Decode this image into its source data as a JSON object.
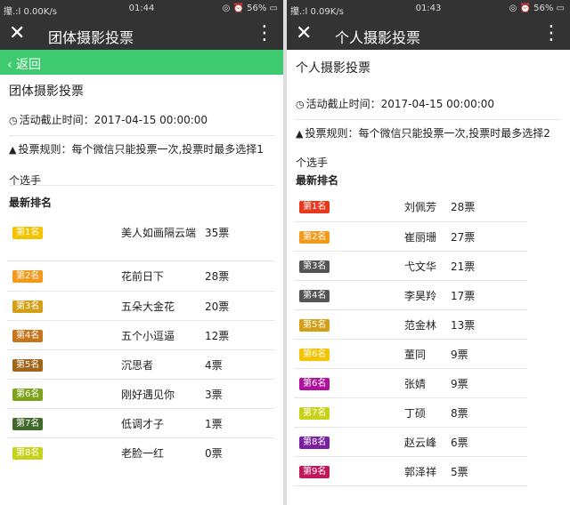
{
  "status_left": {
    "signal": "攥.:l",
    "speed": "0.00K/s",
    "time": "01:44",
    "battery": "56%"
  },
  "status_right": {
    "signal": "攥.:l",
    "speed": "0.09K/s",
    "time": "01:43",
    "battery": "56%"
  },
  "left": {
    "nav_title": "团体摄影投票",
    "back_label": "‹ 返回",
    "page_title": "团体摄影投票",
    "deadline": "活动截止时间：2017-04-15 00:00:00",
    "rule_line1": "投票规则：每个微信只能投票一次,投票时最多选择1",
    "rule_line2": "个选手",
    "section": "最新排名",
    "rows": [
      {
        "rank": "第1名",
        "color": "#f5c400",
        "name": "美人如画隔云端",
        "votes": "35票"
      },
      {
        "rank": "第2名",
        "color": "#f39a1d",
        "name": "花前日下",
        "votes": "28票"
      },
      {
        "rank": "第3名",
        "color": "#d4a017",
        "name": "五朵大金花",
        "votes": "20票"
      },
      {
        "rank": "第4名",
        "color": "#c8741a",
        "name": "五个小逗逼",
        "votes": "12票"
      },
      {
        "rank": "第5名",
        "color": "#a0661a",
        "name": "沉思者",
        "votes": "4票"
      },
      {
        "rank": "第6名",
        "color": "#7ea21a",
        "name": "刚好遇见你",
        "votes": "3票"
      },
      {
        "rank": "第7名",
        "color": "#3f6a2c",
        "name": "低调才子",
        "votes": "1票"
      },
      {
        "rank": "第8名",
        "color": "#c6d21a",
        "name": "老脸一红",
        "votes": "0票"
      }
    ]
  },
  "right": {
    "nav_title": "个人摄影投票",
    "page_title": "个人摄影投票",
    "deadline": "活动截止时间：2017-04-15 00:00:00",
    "rule_line1": "投票规则：每个微信只能投票一次,投票时最多选择2",
    "rule_line2": "个选手",
    "section": "最新排名",
    "rows": [
      {
        "rank": "第1名",
        "color": "#e8391e",
        "name": "刘佩芳",
        "votes": "28票"
      },
      {
        "rank": "第2名",
        "color": "#f39a1d",
        "name": "崔丽珊",
        "votes": "27票"
      },
      {
        "rank": "第3名",
        "color": "#555555",
        "name": "弋文华",
        "votes": "21票"
      },
      {
        "rank": "第4名",
        "color": "#555555",
        "name": "李昊羚",
        "votes": "17票"
      },
      {
        "rank": "第5名",
        "color": "#d4a017",
        "name": "范金林",
        "votes": "13票"
      },
      {
        "rank": "第6名",
        "color": "#f5c400",
        "name": "董同",
        "votes": "9票"
      },
      {
        "rank": "第6名",
        "color": "#b0109c",
        "name": "张婧",
        "votes": "9票"
      },
      {
        "rank": "第7名",
        "color": "#c6d21a",
        "name": "丁硕",
        "votes": "8票"
      },
      {
        "rank": "第8名",
        "color": "#7b1fa2",
        "name": "赵云峰",
        "votes": "6票"
      },
      {
        "rank": "第9名",
        "color": "#c2185b",
        "name": "郭泽祥",
        "votes": "5票"
      }
    ]
  },
  "icons": {
    "close": "close-icon",
    "more": "more-vertical-icon",
    "clock": "clock-icon",
    "warning": "warning-icon"
  }
}
